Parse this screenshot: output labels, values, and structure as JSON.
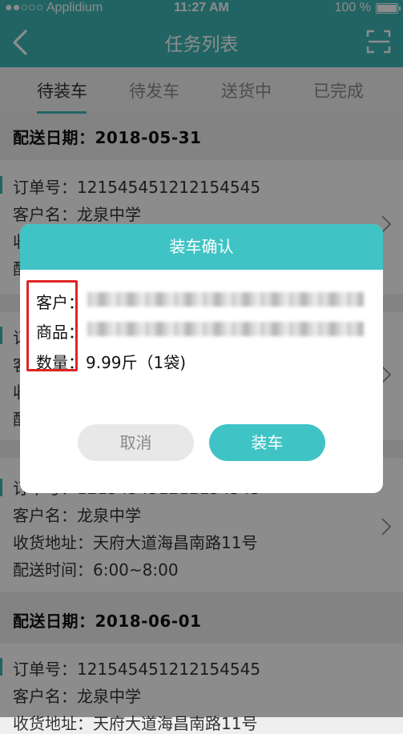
{
  "status_bar": {
    "carrier": "●●○○○ Applidium",
    "time": "11:27 AM",
    "battery": "100 %"
  },
  "nav": {
    "title": "任务列表"
  },
  "tabs": [
    {
      "label": "待装车",
      "active": true
    },
    {
      "label": "待发车",
      "active": false
    },
    {
      "label": "送货中",
      "active": false
    },
    {
      "label": "已完成",
      "active": false
    }
  ],
  "groups": [
    {
      "date_label": "配送日期：2018-05-31"
    },
    {
      "date_label": "配送日期：2018-06-01"
    }
  ],
  "cards": [
    {
      "order": "订单号：121545451212154545",
      "customer": "客户名：龙泉中学",
      "address": "收",
      "time": "配"
    },
    {
      "order": "订",
      "customer": "客",
      "address": "收",
      "time": "配"
    },
    {
      "order": "订单号：121545451212154545",
      "customer": "客户名：龙泉中学",
      "address": "收货地址：天府大道海昌南路11号",
      "time": "配送时间：6:00~8:00"
    },
    {
      "order": "订单号：121545451212154545",
      "customer": "客户名：龙泉中学",
      "address": "收货地址：天府大道海昌南路11号"
    }
  ],
  "modal": {
    "title": "装车确认",
    "customer_label": "客户：",
    "goods_label": "商品：",
    "quantity_label": "数量：",
    "quantity_value": "9.99斤（1袋)",
    "cancel_label": "取消",
    "confirm_label": "装车"
  },
  "colors": {
    "accent": "#3fb7b6",
    "modal_header": "#40c3c5",
    "highlight": "#e02424"
  }
}
